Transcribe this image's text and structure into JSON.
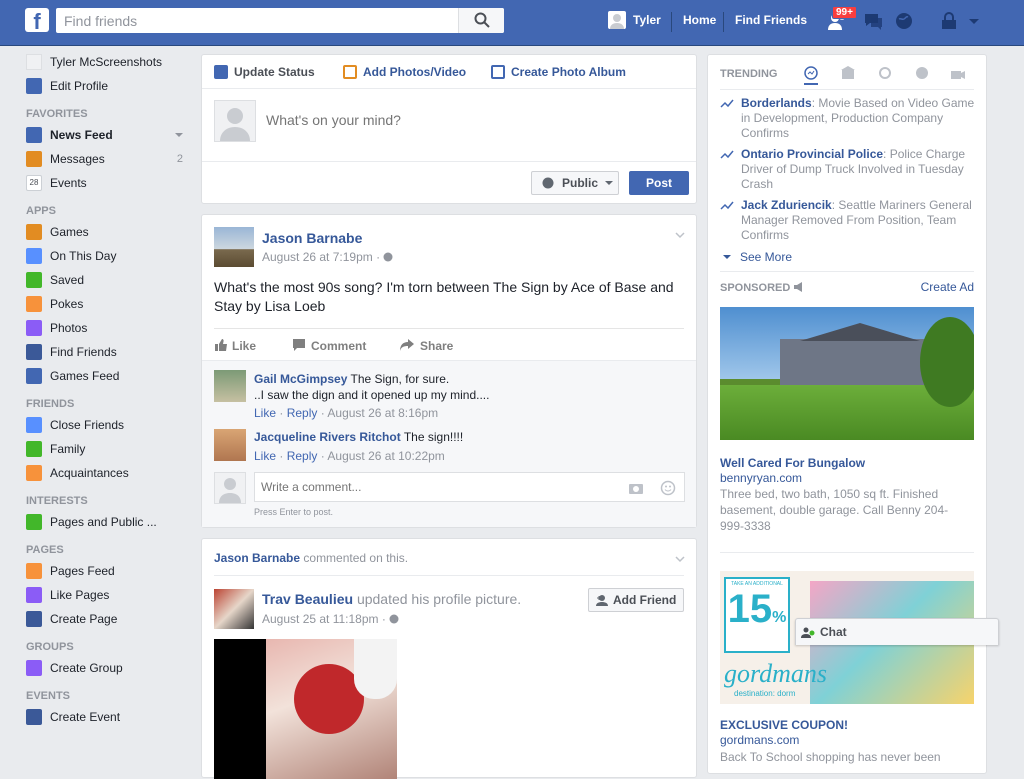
{
  "app": {
    "name": "Facebook"
  },
  "topbar": {
    "search_placeholder": "Find friends",
    "user_name": "Tyler",
    "home_label": "Home",
    "find_friends_label": "Find Friends",
    "friend_requests_count": "99+"
  },
  "leftnav": {
    "profile_name": "Tyler McScreenshots",
    "edit_profile": "Edit Profile",
    "sections": [
      {
        "header": "FAVORITES",
        "items": [
          {
            "label": "News Feed",
            "icon": "news-feed-icon",
            "bold": true
          },
          {
            "label": "Messages",
            "icon": "messages-icon",
            "count": "2"
          },
          {
            "label": "Events",
            "icon": "events-calendar-icon",
            "badge": "28"
          }
        ]
      },
      {
        "header": "APPS",
        "items": [
          {
            "label": "Games",
            "icon": "games-icon"
          },
          {
            "label": "On This Day",
            "icon": "on-this-day-icon"
          },
          {
            "label": "Saved",
            "icon": "saved-icon"
          },
          {
            "label": "Pokes",
            "icon": "pokes-icon"
          },
          {
            "label": "Photos",
            "icon": "photos-icon"
          },
          {
            "label": "Find Friends",
            "icon": "find-friends-icon"
          },
          {
            "label": "Games Feed",
            "icon": "games-feed-icon"
          }
        ]
      },
      {
        "header": "FRIENDS",
        "items": [
          {
            "label": "Close Friends",
            "icon": "close-friends-icon"
          },
          {
            "label": "Family",
            "icon": "family-icon"
          },
          {
            "label": "Acquaintances",
            "icon": "acquaintances-icon"
          }
        ]
      },
      {
        "header": "INTERESTS",
        "items": [
          {
            "label": "Pages and Public ...",
            "icon": "pages-public-icon"
          }
        ]
      },
      {
        "header": "PAGES",
        "items": [
          {
            "label": "Pages Feed",
            "icon": "pages-feed-icon"
          },
          {
            "label": "Like Pages",
            "icon": "like-pages-icon"
          },
          {
            "label": "Create Page",
            "icon": "create-page-icon"
          }
        ]
      },
      {
        "header": "GROUPS",
        "items": [
          {
            "label": "Create Group",
            "icon": "create-group-icon"
          }
        ]
      },
      {
        "header": "EVENTS",
        "items": [
          {
            "label": "Create Event",
            "icon": "create-event-icon"
          }
        ]
      }
    ]
  },
  "composer": {
    "tabs": [
      "Update Status",
      "Add Photos/Video",
      "Create Photo Album"
    ],
    "placeholder": "What's on your mind?",
    "privacy_label": "Public",
    "post_label": "Post"
  },
  "post1": {
    "author": "Jason Barnabe",
    "time": "August 26 at 7:19pm",
    "text": "What's the most 90s song? I'm torn between The Sign by Ace of Base and Stay by Lisa Loeb",
    "actions": [
      "Like",
      "Comment",
      "Share"
    ],
    "comments": [
      {
        "author": "Gail McGimpsey",
        "text": "The Sign, for sure.",
        "text2": "..I saw the dign and it opened up my mind....",
        "like": "Like",
        "reply": "Reply",
        "time": "August 26 at 8:16pm"
      },
      {
        "author": "Jacqueline Rivers Ritchot",
        "text": "The sign!!!!",
        "like": "Like",
        "reply": "Reply",
        "time": "August 26 at 10:22pm"
      }
    ],
    "comment_placeholder": "Write a comment...",
    "press_enter": "Press Enter to post."
  },
  "post2": {
    "context_author": "Jason Barnabe",
    "context_text": "commented on this.",
    "author": "Trav Beaulieu",
    "action_text": "updated his profile picture.",
    "time": "August 25 at 11:18pm",
    "add_friend_label": "Add Friend"
  },
  "right": {
    "trending_header": "TRENDING",
    "trending": [
      {
        "title": "Borderlands",
        "desc": "Movie Based on Video Game in Development, Production Company Confirms"
      },
      {
        "title": "Ontario Provincial Police",
        "desc": "Police Charge Driver of Dump Truck Involved in Tuesday Crash"
      },
      {
        "title": "Jack Zduriencik",
        "desc": "Seattle Mariners General Manager Removed From Position, Team Confirms"
      }
    ],
    "see_more": "See More",
    "sponsored_header": "SPONSORED",
    "create_ad": "Create Ad",
    "ads": [
      {
        "title": "Well Cared For Bungalow",
        "domain": "bennyryan.com",
        "desc": "Three bed, two bath, 1050 sq ft. Finished basement, double garage. Call Benny 204-999-3338"
      },
      {
        "title": "EXCLUSIVE COUPON!",
        "domain": "gordmans.com",
        "desc": "Back To School shopping has never been",
        "brand": "gordmans",
        "brand_sub": "destination: dorm",
        "promo_pct": "15",
        "promo_top": "TAKE AN ADDITIONAL"
      }
    ]
  },
  "chat": {
    "label": "Chat"
  },
  "colors": {
    "brand_blue": "#4267b2",
    "link_blue": "#365899",
    "bg": "#e9ebee",
    "badge_red": "#fa3e3e",
    "online_green": "#42b72a"
  }
}
